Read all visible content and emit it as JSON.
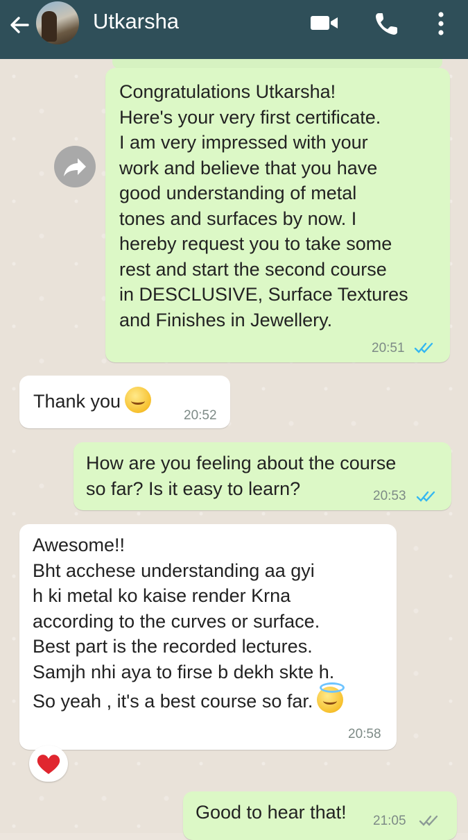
{
  "header": {
    "contact_name": "Utkarsha",
    "icons": [
      "back-arrow-icon",
      "avatar",
      "video-call-icon",
      "voice-call-icon",
      "more-options-icon"
    ]
  },
  "messages": [
    {
      "direction": "outgoing",
      "text": "Congratulations Utkarsha!\nHere's your very first certificate.\nI am very impressed with your\nwork and believe that you have\ngood understanding of metal\ntones  and surfaces by now. I\nhereby request you to take some\nrest and start the second course\nin DESCLUSIVE,  Surface Textures\nand Finishes in Jewellery.",
      "time": "20:51",
      "status": "read"
    },
    {
      "direction": "incoming",
      "text": "Thank you",
      "time": "20:52",
      "emoji": "smiling-face"
    },
    {
      "direction": "outgoing",
      "text": "How are you feeling about the course\nso far? Is it easy to learn?",
      "time": "20:53",
      "status": "read"
    },
    {
      "direction": "incoming",
      "text": "Awesome!!\nBht acchese understanding aa gyi\nh ki metal ko kaise render Krna\naccording to the curves or surface.\nBest part is the recorded lectures.\nSamjh nhi aya to firse b dekh skte h.",
      "text_last": "So yeah , it's a best course so far.",
      "time": "20:58",
      "emoji": "smiling-face-with-halo",
      "reaction": "red-heart"
    },
    {
      "direction": "outgoing",
      "text": "Good to hear that!",
      "time": "21:05",
      "status": "delivered"
    }
  ],
  "colors": {
    "header_bg": "#2f4f59",
    "outgoing_bubble": "#dcf8c6",
    "incoming_bubble": "#ffffff",
    "read_ticks": "#34b7f1",
    "delivered_ticks": "#8c9a96"
  }
}
